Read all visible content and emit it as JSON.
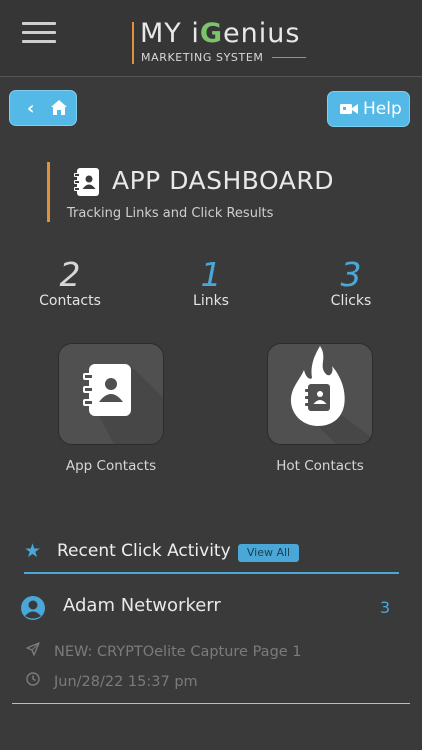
{
  "header": {
    "logo_main_prefix": "MY i",
    "logo_g": "G",
    "logo_main_suffix": "enius",
    "logo_sub": "MARKETING SYSTEM"
  },
  "toolbar": {
    "back_icon": "chevron-left-icon",
    "home_icon": "home-icon",
    "help_label": "Help",
    "help_icon": "video-camera-icon"
  },
  "page": {
    "title": "APP DASHBOARD",
    "subtitle": "Tracking Links and Click Results"
  },
  "stats": [
    {
      "value": "2",
      "label": "Contacts",
      "color": "#d6d6d6"
    },
    {
      "value": "1",
      "label": "Links",
      "color": "#4aa8d8"
    },
    {
      "value": "3",
      "label": "Clicks",
      "color": "#4aa8d8"
    }
  ],
  "tiles": [
    {
      "label": "App Contacts",
      "icon": "contact-book-icon"
    },
    {
      "label": "Hot Contacts",
      "icon": "flame-contact-icon"
    }
  ],
  "recent": {
    "title": "Recent Click Activity",
    "view_all": "View All",
    "items": [
      {
        "name": "Adam Networkerr",
        "count": "3",
        "page": "NEW: CRYPTOelite Capture Page 1",
        "timestamp": "Jun/28/22 15:37 pm"
      }
    ]
  },
  "colors": {
    "accent_blue": "#4aa8d8",
    "accent_orange": "#e0913c",
    "background": "#3a3a3a"
  }
}
